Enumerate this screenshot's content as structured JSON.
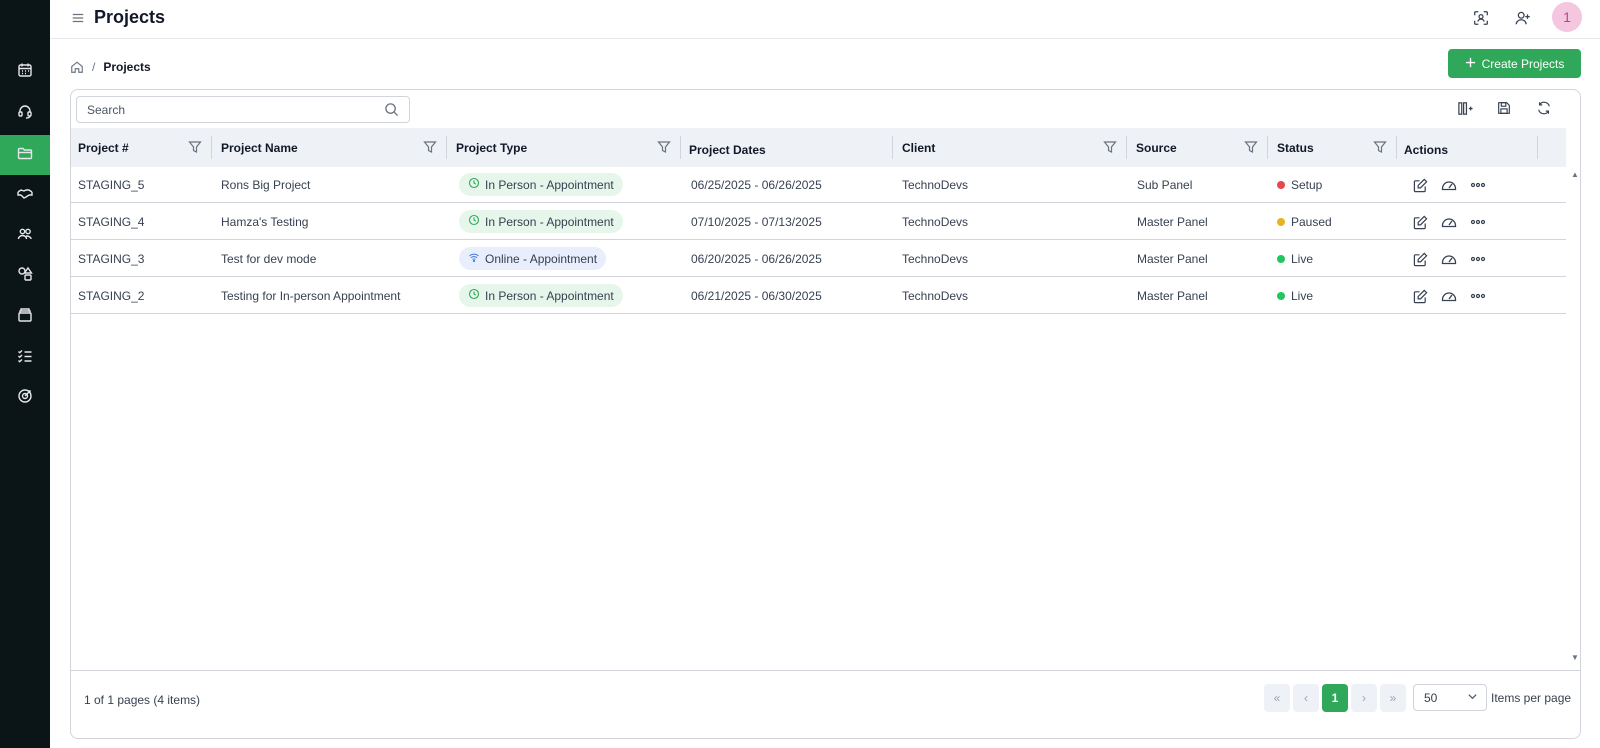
{
  "header": {
    "title": "Projects",
    "avatar_label": "1"
  },
  "breadcrumb": {
    "separator": "/",
    "current": "Projects"
  },
  "create_button_label": "Create Projects",
  "search": {
    "placeholder": "Search",
    "value": ""
  },
  "columns": [
    {
      "label": "Project #"
    },
    {
      "label": "Project Name"
    },
    {
      "label": "Project Type"
    },
    {
      "label": "Project Dates"
    },
    {
      "label": "Client"
    },
    {
      "label": "Source"
    },
    {
      "label": "Status"
    },
    {
      "label": "Actions"
    }
  ],
  "rows": [
    {
      "id": "STAGING_5",
      "name": "Rons Big Project",
      "type": "In Person - Appointment",
      "type_kind": "in-person",
      "dates": "06/25/2025 - 06/26/2025",
      "client": "TechnoDevs",
      "source": "Sub Panel",
      "status": "Setup",
      "status_color": "#e5484d"
    },
    {
      "id": "STAGING_4",
      "name": "Hamza's Testing",
      "type": "In Person - Appointment",
      "type_kind": "in-person",
      "dates": "07/10/2025 - 07/13/2025",
      "client": "TechnoDevs",
      "source": "Master Panel",
      "status": "Paused",
      "status_color": "#e6b422"
    },
    {
      "id": "STAGING_3",
      "name": "Test for dev mode",
      "type": "Online - Appointment",
      "type_kind": "online",
      "dates": "06/20/2025 - 06/26/2025",
      "client": "TechnoDevs",
      "source": "Master Panel",
      "status": "Live",
      "status_color": "#22c55e"
    },
    {
      "id": "STAGING_2",
      "name": "Testing for In-person Appointment",
      "type": "In Person - Appointment",
      "type_kind": "in-person",
      "dates": "06/21/2025 - 06/30/2025",
      "client": "TechnoDevs",
      "source": "Master Panel",
      "status": "Live",
      "status_color": "#22c55e"
    }
  ],
  "pagination": {
    "info": "1 of 1 pages (4 items)",
    "current_page": "1",
    "page_size": "50",
    "items_per_page_label": "Items per page"
  },
  "colors": {
    "accent": "#2fa85a",
    "sidebar": "#0b1416",
    "header_row": "#eef1f6"
  },
  "sidebar": {
    "items": [
      {
        "icon": "calendar-icon"
      },
      {
        "icon": "headset-icon"
      },
      {
        "icon": "folder-icon",
        "active": true
      },
      {
        "icon": "handshake-icon"
      },
      {
        "icon": "users-icon"
      },
      {
        "icon": "shapes-icon"
      },
      {
        "icon": "archive-icon"
      },
      {
        "icon": "checklist-icon"
      },
      {
        "icon": "target-icon"
      }
    ]
  }
}
